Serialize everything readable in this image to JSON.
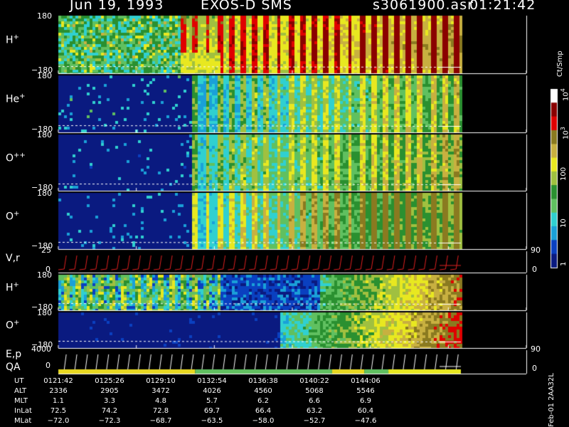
{
  "header": {
    "date": "Jun 19, 1993",
    "instrument": "EXOS-D SMS",
    "file": "s3061900.asr",
    "time": "01:21:42"
  },
  "colors": {
    "background": "#000000",
    "text": "#ffffff",
    "plot_bg": "#0a1a80",
    "no_data": "#000000"
  },
  "colorbar": {
    "label": "Ct/Smp",
    "tick_labels": [
      "1",
      "10",
      "100",
      "10",
      "3",
      "10",
      "4"
    ],
    "ticks": [
      {
        "value": 1,
        "text": "1"
      },
      {
        "value": 10,
        "text": "10"
      },
      {
        "value": 100,
        "text": "100"
      },
      {
        "value": 1000,
        "text": "10",
        "exp": "3"
      },
      {
        "value": 10000,
        "text": "10",
        "exp": "4"
      }
    ],
    "stops": [
      "#0a1a80",
      "#0a40c0",
      "#1aa0d8",
      "#30d0d0",
      "#60c060",
      "#2a9030",
      "#a0c040",
      "#e8e820",
      "#c8b040",
      "#8a7a20",
      "#e00000",
      "#8a0000",
      "#ffffff"
    ]
  },
  "chart_data": {
    "type": "heatmap",
    "x_range": [
      "01:21:42",
      "01:45:00"
    ],
    "data_end_fraction": 0.86,
    "panels": [
      {
        "key": "h1",
        "label": "H",
        "sup": "+",
        "ymax": "180",
        "ymin": "−180",
        "y_range": [
          -180,
          180
        ],
        "profile": "hplus"
      },
      {
        "key": "he",
        "label": "He",
        "sup": "+",
        "ymax": "180",
        "ymin": "−180",
        "y_range": [
          -180,
          180
        ],
        "profile": "minor"
      },
      {
        "key": "opp",
        "label": "O",
        "sup": "++",
        "ymax": "180",
        "ymin": "−180",
        "y_range": [
          -180,
          180
        ],
        "profile": "minor2"
      },
      {
        "key": "o1",
        "label": "O",
        "sup": "+",
        "ymax": "180",
        "ymin": "−180",
        "y_range": [
          -180,
          180
        ],
        "profile": "oplus"
      },
      {
        "key": "h2",
        "label": "H",
        "sup": "+",
        "ymax": "180",
        "ymin": "−180",
        "y_range": [
          -180,
          180
        ],
        "profile": "hplus2"
      },
      {
        "key": "o2",
        "label": "O",
        "sup": "+",
        "ymax": "180",
        "ymin": "−180",
        "y_range": [
          -180,
          180
        ],
        "profile": "oplus2"
      }
    ],
    "vr_panel": {
      "label": "V,r",
      "ymax": "25",
      "ymin": "0",
      "right_top": "90",
      "right_bottom": "0",
      "sweeps": 38
    },
    "ep_panel": {
      "label": "E,p",
      "label2": "QA",
      "ymax": "4000",
      "ymin": "0",
      "right_top": "90",
      "right_bottom": "0",
      "sweeps": 38
    },
    "table": {
      "rows": [
        {
          "name": "UT",
          "values": [
            "0121:42",
            "0125:26",
            "0129:10",
            "0132:54",
            "0136:38",
            "0140:22",
            "0144:06"
          ]
        },
        {
          "name": "ALT",
          "values": [
            "2336",
            "2905",
            "3472",
            "4026",
            "4560",
            "5068",
            "5546"
          ]
        },
        {
          "name": "MLT",
          "values": [
            "1.1",
            "3.3",
            "4.8",
            "5.7",
            "6.2",
            "6.6",
            "6.9"
          ]
        },
        {
          "name": "InLat",
          "values": [
            "72.5",
            "74.2",
            "72.8",
            "69.7",
            "66.4",
            "63.2",
            "60.4"
          ]
        },
        {
          "name": "MLat",
          "values": [
            "−72.0",
            "−72.3",
            "−68.7",
            "−63.5",
            "−58.0",
            "−52.7",
            "−47.6"
          ]
        }
      ]
    }
  },
  "footer": {
    "stamp": "Feb-01 2AA32L"
  }
}
